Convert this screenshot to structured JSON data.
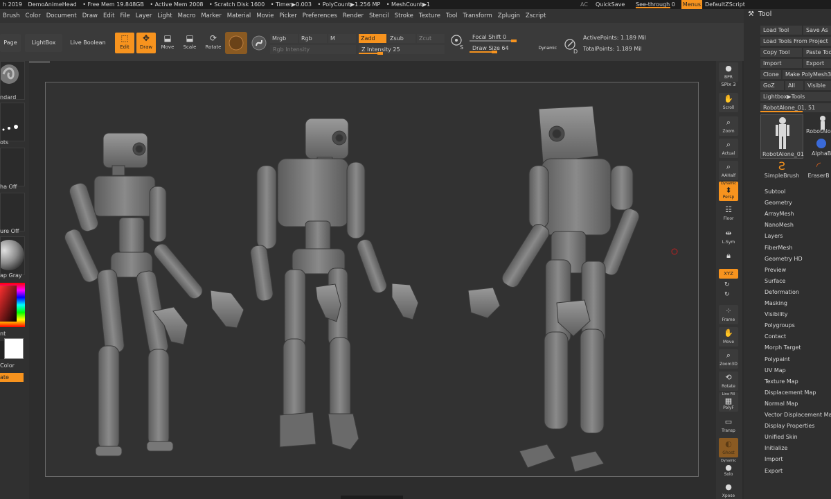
{
  "status_bar": {
    "version": "h 2019",
    "document": "DemoAnimeHead",
    "free_mem": "• Free Mem 19.848GB",
    "active_mem": "• Active Mem 2008",
    "scratch_disk": "• Scratch Disk 1600",
    "timer": "• Timer▶0.003",
    "polycount": "• PolyCount▶1.256 MP",
    "meshcount": "• MeshCount▶1",
    "ac": "AC",
    "quicksave": "QuickSave",
    "see_through": "See-through  0",
    "menus": "Menus",
    "script": "DefaultZScript"
  },
  "menubar": [
    "Brush",
    "Color",
    "Document",
    "Draw",
    "Edit",
    "File",
    "Layer",
    "Light",
    "Macro",
    "Marker",
    "Material",
    "Movie",
    "Picker",
    "Preferences",
    "Render",
    "Stencil",
    "Stroke",
    "Texture",
    "Tool",
    "Transform",
    "Zplugin",
    "Zscript"
  ],
  "shelf": {
    "page_btn": "Page",
    "lightbox_btn": "LightBox",
    "live_boolean_btn": "Live Boolean",
    "edit": "Edit",
    "draw": "Draw",
    "move": "Move",
    "scale": "Scale",
    "rotate": "Rotate",
    "mrgb": "Mrgb",
    "rgb": "Rgb",
    "m": "M",
    "zadd": "Zadd",
    "zsub": "Zsub",
    "zcut": "Zcut",
    "rgb_intensity": "Rgb Intensity",
    "z_intensity": "Z Intensity 25",
    "focal_shift": "Focal Shift 0",
    "draw_size": "Draw Size 64",
    "dynamic": "Dynamic",
    "active_points": "ActivePoints: 1.189 Mil",
    "total_points": "TotalPoints: 1.189 Mil",
    "z_intensity_level": 0.25,
    "focal_shift_level": 0.5,
    "draw_size_level": 0.28
  },
  "left_tray": {
    "brush_label": "ndard",
    "stroke_label": "ots",
    "alpha_label": "ha Off",
    "texture_label": "ure Off",
    "material_label": "ap Gray",
    "gradient_label": "nt",
    "color_label": "Color",
    "switch_label": "ate"
  },
  "right_dock": {
    "bpr": "BPR",
    "spix": "SPix 3",
    "scroll": "Scroll",
    "zoom": "Zoom",
    "actual": "Actual",
    "aahalf": "AAHalf",
    "dynamic": "Dynamic",
    "persp": "Persp",
    "floor": "Floor",
    "lsym": "L.Sym",
    "xyz": "XYZ",
    "frame": "Frame",
    "move": "Move",
    "zoom3d": "Zoom3D",
    "rotate": "Rotate",
    "line_fill": "Line Fill",
    "polyf": "PolyF",
    "transp": "Transp",
    "ghost": "Ghost",
    "dynamic2": "Dynamic",
    "solo": "Solo",
    "xpose": "Xpose"
  },
  "tool_panel": {
    "title": "Tool",
    "load_tool": "Load Tool",
    "save_as": "Save As",
    "load_from_project": "Load Tools From Project",
    "copy_tool": "Copy Tool",
    "paste_tool": "Paste Too",
    "import": "Import",
    "export": "Export",
    "clone": "Clone",
    "make_polymesh": "Make PolyMesh3D",
    "goz": "GoZ",
    "all": "All",
    "visible": "Visible",
    "lightbox_tools": "Lightbox▶Tools",
    "current_tool": "RobotAlone_01. 51",
    "thumbs": [
      "RobotAlone_01",
      "RobotAlo",
      "SimpleBrush",
      "EraserB",
      "AlphaB"
    ],
    "subpalettes": [
      "Subtool",
      "Geometry",
      "ArrayMesh",
      "NanoMesh",
      "Layers",
      "FiberMesh",
      "Geometry HD",
      "Preview",
      "Surface",
      "Deformation",
      "Masking",
      "Visibility",
      "Polygroups",
      "Contact",
      "Morph Target",
      "Polypaint",
      "UV Map",
      "Texture Map",
      "Displacement Map",
      "Normal Map",
      "Vector Displacement Map",
      "Display Properties",
      "Unified Skin",
      "Initialize",
      "Import",
      "Export"
    ]
  },
  "colors": {
    "accent": "#f7931e",
    "background": "#2b2b2b",
    "panel": "#333333"
  }
}
